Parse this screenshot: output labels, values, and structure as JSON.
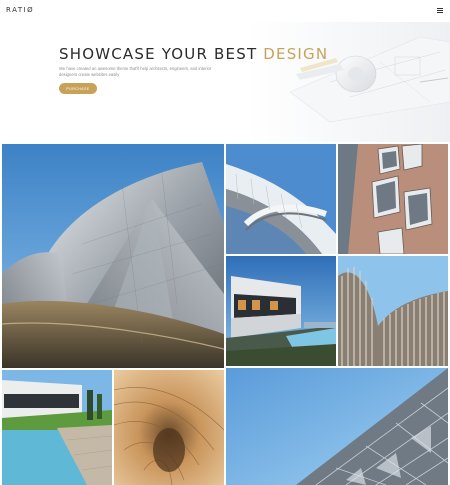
{
  "header": {
    "logo": "RATIØ",
    "menu_icon": "hamburger-menu-icon"
  },
  "hero": {
    "title_main": "SHOWCASE YOUR BEST ",
    "title_accent": "DESIGN",
    "description": "We have created an awesome theme that'll help architects, engineers, and interior designers create websites easily",
    "cta_label": "PURCHASE"
  },
  "colors": {
    "accent": "#c9a25a",
    "text": "#2b2b2b",
    "sky": "#5e9bd6"
  },
  "gallery": {
    "tiles": [
      "disney-concert-hall-photo",
      "white-arch-photo",
      "angled-windows-facade-photo",
      "modern-villa-pool-photo",
      "wave-louvers-photo",
      "white-house-lawn-photo",
      "wooden-ribbon-photo",
      "triangular-glass-facade-photo"
    ]
  }
}
